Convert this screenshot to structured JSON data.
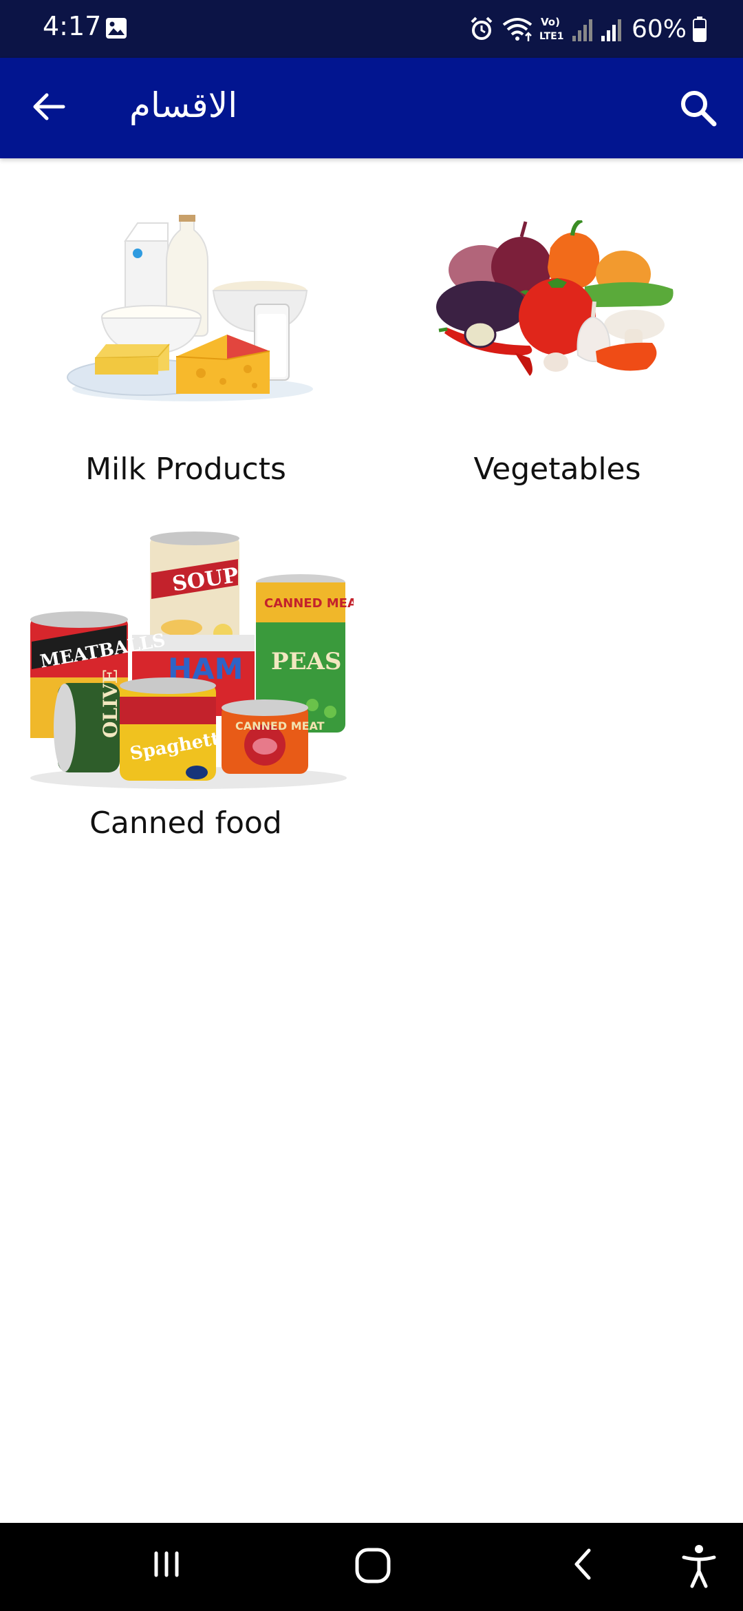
{
  "status_bar": {
    "time": "4:17",
    "battery": "60%",
    "icons": [
      "gallery-icon",
      "alarm-icon",
      "wifi-icon",
      "volte-icon",
      "signal-icon",
      "signal-icon",
      "battery-icon"
    ]
  },
  "app_bar": {
    "title": "الاقسام",
    "back_icon": "arrow-left-icon",
    "search_icon": "search-icon"
  },
  "categories": [
    {
      "label": "Milk Products",
      "image": "milk-products-image"
    },
    {
      "label": "Vegetables",
      "image": "vegetables-image"
    },
    {
      "label": "Canned food",
      "image": "canned-food-image"
    }
  ],
  "nav_bar": {
    "icons": [
      "recent-apps-icon",
      "home-icon",
      "back-icon",
      "accessibility-icon"
    ]
  },
  "colors": {
    "status_bar": "#0c1446",
    "app_bar": "#021590",
    "background": "#ffffff",
    "nav_bar": "#000000"
  }
}
